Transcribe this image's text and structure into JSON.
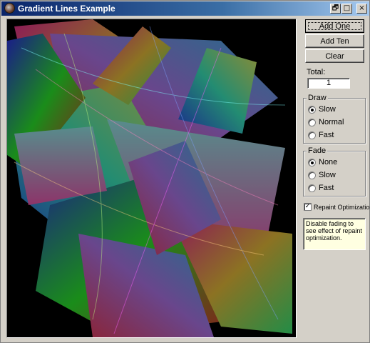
{
  "window": {
    "title": "Gradient Lines Example",
    "buttons": {
      "minimize": "🗗",
      "maximize": "□",
      "close": "×"
    }
  },
  "controls": {
    "add_one": "Add One",
    "add_ten": "Add Ten",
    "clear": "Clear",
    "total_label": "Total:",
    "total_value": "1",
    "draw": {
      "title": "Draw",
      "options": [
        "Slow",
        "Normal",
        "Fast"
      ],
      "selected": "Slow"
    },
    "fade": {
      "title": "Fade",
      "options": [
        "None",
        "Slow",
        "Fast"
      ],
      "selected": "None"
    },
    "repaint": {
      "label": "Repaint Optimization",
      "checked": true
    },
    "note": "Disable fading to see effect of repaint optimization."
  },
  "colors": {
    "title_gradient_start": "#0a246a",
    "title_gradient_end": "#a6caf0",
    "canvas_bg": "#000000",
    "note_bg": "#ffffe1"
  }
}
